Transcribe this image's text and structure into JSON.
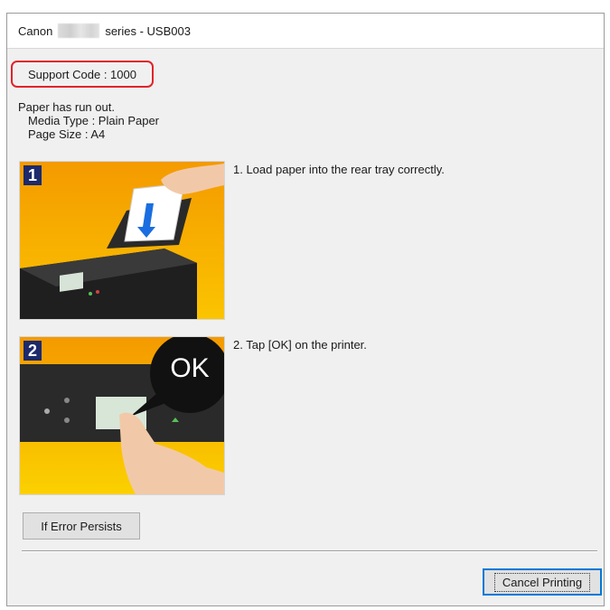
{
  "window": {
    "title_prefix": "Canon",
    "title_suffix": "series - USB003"
  },
  "support_code": "Support Code : 1000",
  "message": {
    "line1": "Paper has run out.",
    "media_type": "Media Type : Plain Paper",
    "page_size": "Page Size : A4"
  },
  "steps": [
    {
      "number": "1",
      "text": "1.  Load paper into the rear tray correctly."
    },
    {
      "number": "2",
      "text": "2.  Tap [OK] on the printer.",
      "bubble": "OK"
    }
  ],
  "buttons": {
    "if_error_persists": "If Error Persists",
    "cancel_printing": "Cancel Printing"
  },
  "colors": {
    "highlight_border": "#e0242b",
    "illustration_bg": "#f7a800",
    "step_badge": "#1d2a6b"
  }
}
